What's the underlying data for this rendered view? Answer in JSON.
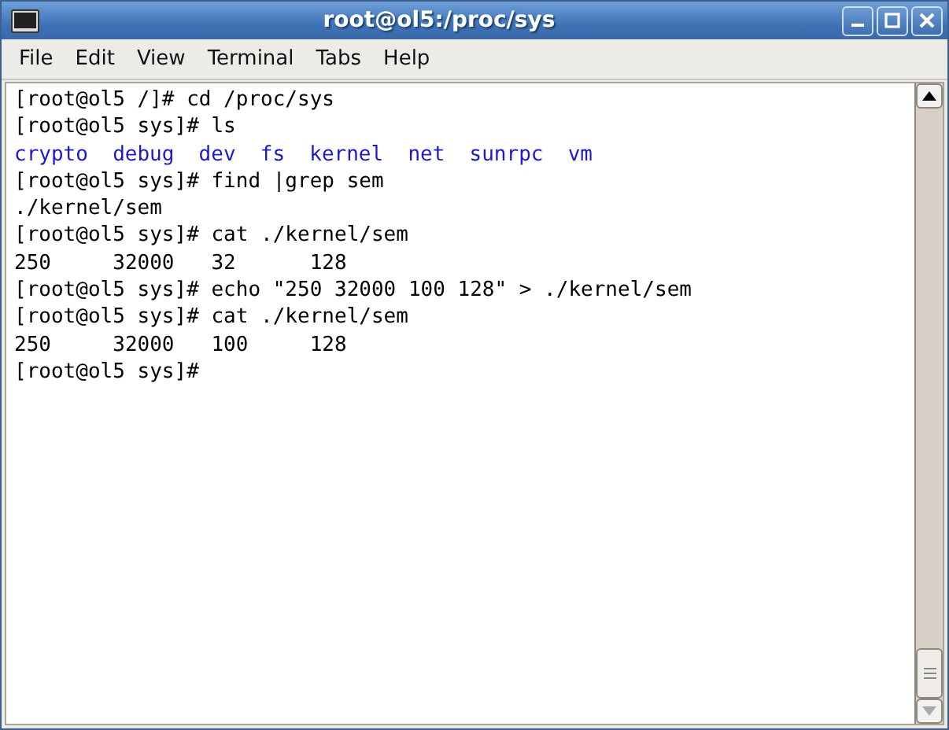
{
  "window": {
    "title": "root@ol5:/proc/sys"
  },
  "menu": [
    {
      "label": "File"
    },
    {
      "label": "Edit"
    },
    {
      "label": "View"
    },
    {
      "label": "Terminal"
    },
    {
      "label": "Tabs"
    },
    {
      "label": "Help"
    }
  ],
  "terminal": {
    "lines": [
      {
        "kind": "text",
        "text": "[root@ol5 /]# cd /proc/sys"
      },
      {
        "kind": "text",
        "text": "[root@ol5 sys]# ls"
      },
      {
        "kind": "listing",
        "items": [
          {
            "name": "crypto",
            "color": "#1a1ad0"
          },
          {
            "name": "debug",
            "color": "#1a1ad0"
          },
          {
            "name": "dev",
            "color": "#1a1ad0"
          },
          {
            "name": "fs",
            "color": "#1a1ad0"
          },
          {
            "name": "kernel",
            "color": "#1a1ad0"
          },
          {
            "name": "net",
            "color": "#1a1ad0"
          },
          {
            "name": "sunrpc",
            "color": "#1a1ad0"
          },
          {
            "name": "vm",
            "color": "#1a1ad0"
          }
        ]
      },
      {
        "kind": "text",
        "text": "[root@ol5 sys]# find |grep sem"
      },
      {
        "kind": "text",
        "text": "./kernel/sem"
      },
      {
        "kind": "text",
        "text": "[root@ol5 sys]# cat ./kernel/sem"
      },
      {
        "kind": "text",
        "text": "250\t32000\t32\t128"
      },
      {
        "kind": "text",
        "text": "[root@ol5 sys]# echo \"250 32000 100 128\" > ./kernel/sem"
      },
      {
        "kind": "text",
        "text": "[root@ol5 sys]# cat ./kernel/sem"
      },
      {
        "kind": "text",
        "text": "250\t32000\t100\t128"
      },
      {
        "kind": "text",
        "text": "[root@ol5 sys]#"
      }
    ]
  }
}
